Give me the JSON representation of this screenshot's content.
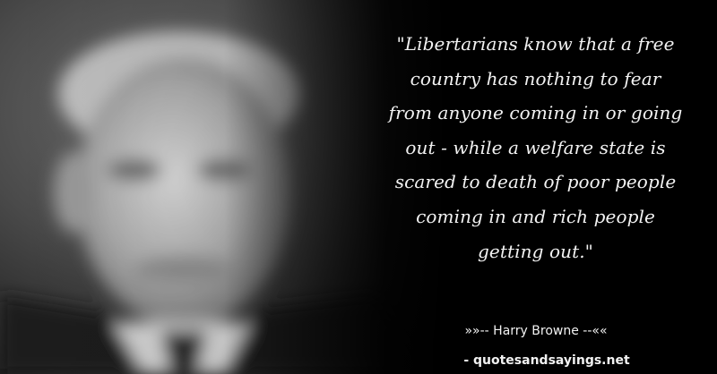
{
  "quote": {
    "lines": [
      "\"Libertarians know that a free",
      "country has nothing to fear",
      "from anyone coming in or going",
      "out - while a welfare state is",
      "scared to death of poor people",
      "coming in and rich people",
      "getting out.\""
    ]
  },
  "attribution": {
    "author_line": "»»-- Harry Browne --««"
  },
  "watermark": {
    "text": "- quotesandsayings.net"
  },
  "colors": {
    "background": "#000000",
    "text": "#f2f2f2"
  }
}
